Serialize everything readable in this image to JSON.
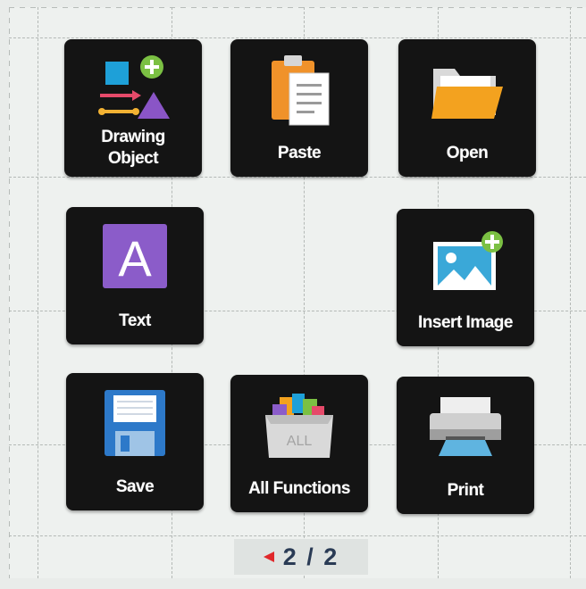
{
  "tiles": {
    "drawing_object": {
      "label": "Drawing Object",
      "icon": "drawing-object-icon"
    },
    "paste": {
      "label": "Paste",
      "icon": "clipboard-icon"
    },
    "open": {
      "label": "Open",
      "icon": "folder-icon"
    },
    "text": {
      "label": "Text",
      "icon": "text-icon"
    },
    "insert_image": {
      "label": "Insert Image",
      "icon": "image-add-icon"
    },
    "save": {
      "label": "Save",
      "icon": "floppy-disk-icon"
    },
    "all_functions": {
      "label": "All Functions",
      "icon": "all-functions-icon",
      "box_text": "ALL"
    },
    "print": {
      "label": "Print",
      "icon": "printer-icon"
    }
  },
  "pager": {
    "text": "2 / 2",
    "current": 2,
    "total": 2
  },
  "colors": {
    "tile_bg": "#141414",
    "label": "#ffffff",
    "accent_green": "#7bc043",
    "pager_arrow": "#e0282b",
    "pager_text": "#2a3b55"
  }
}
